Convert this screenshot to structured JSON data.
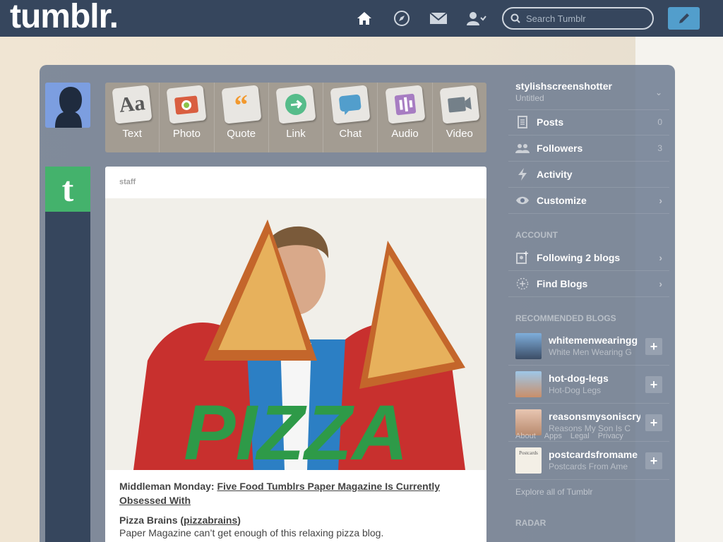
{
  "header": {
    "logo": "tumblr.",
    "search_placeholder": "Search Tumblr",
    "nav_icons": [
      "home-icon",
      "compass-icon",
      "mail-icon",
      "account-icon"
    ]
  },
  "post_types": [
    {
      "label": "Text",
      "icon": "text-post-icon",
      "color": "#5a5a5a"
    },
    {
      "label": "Photo",
      "icon": "photo-post-icon",
      "color": "#d95e40"
    },
    {
      "label": "Quote",
      "icon": "quote-post-icon",
      "color": "#f2992e"
    },
    {
      "label": "Link",
      "icon": "link-post-icon",
      "color": "#56bc8a"
    },
    {
      "label": "Chat",
      "icon": "chat-post-icon",
      "color": "#529ecc"
    },
    {
      "label": "Audio",
      "icon": "audio-post-icon",
      "color": "#a77dc2"
    },
    {
      "label": "Video",
      "icon": "video-post-icon",
      "color": "#748089"
    }
  ],
  "post": {
    "author": "staff",
    "image_text": "PIZZA",
    "title_prefix": "Middleman Monday: ",
    "title_link": "Five Food Tumblrs Paper Magazine Is Currently Obsessed With",
    "sub_prefix": "Pizza Brains (",
    "sub_link": "pizzabrains",
    "sub_suffix": ")",
    "text": "Paper Magazine can’t get enough of this relaxing pizza blog."
  },
  "sidebar": {
    "blog_name": "stylishscreenshotter",
    "blog_subtitle": "Untitled",
    "items": [
      {
        "label": "Posts",
        "count": "0",
        "icon": "posts-icon"
      },
      {
        "label": "Followers",
        "count": "3",
        "icon": "followers-icon"
      },
      {
        "label": "Activity",
        "count": "",
        "icon": "activity-icon"
      },
      {
        "label": "Customize",
        "count": "",
        "icon": "eye-icon"
      }
    ],
    "account_heading": "ACCOUNT",
    "account_items": [
      {
        "label": "Following 2 blogs",
        "icon": "following-icon"
      },
      {
        "label": "Find Blogs",
        "icon": "find-blogs-icon"
      }
    ],
    "recommended_heading": "RECOMMENDED BLOGS",
    "recommended": [
      {
        "name": "whitemenwearingg",
        "subtitle": "White Men Wearing G"
      },
      {
        "name": "hot-dog-legs",
        "subtitle": "Hot-Dog Legs"
      },
      {
        "name": "reasonsmysoniscry",
        "subtitle": "Reasons My Son Is C"
      },
      {
        "name": "postcardsfromame",
        "subtitle": "Postcards From Ame"
      }
    ],
    "footer_links": [
      "About",
      "Apps",
      "Legal",
      "Privacy"
    ],
    "explore": "Explore all of Tumblr",
    "radar_heading": "RADAR"
  },
  "colors": {
    "topbar": "#36465d",
    "compose": "#529ecc",
    "tumblr_avatar": "#44b26c"
  }
}
